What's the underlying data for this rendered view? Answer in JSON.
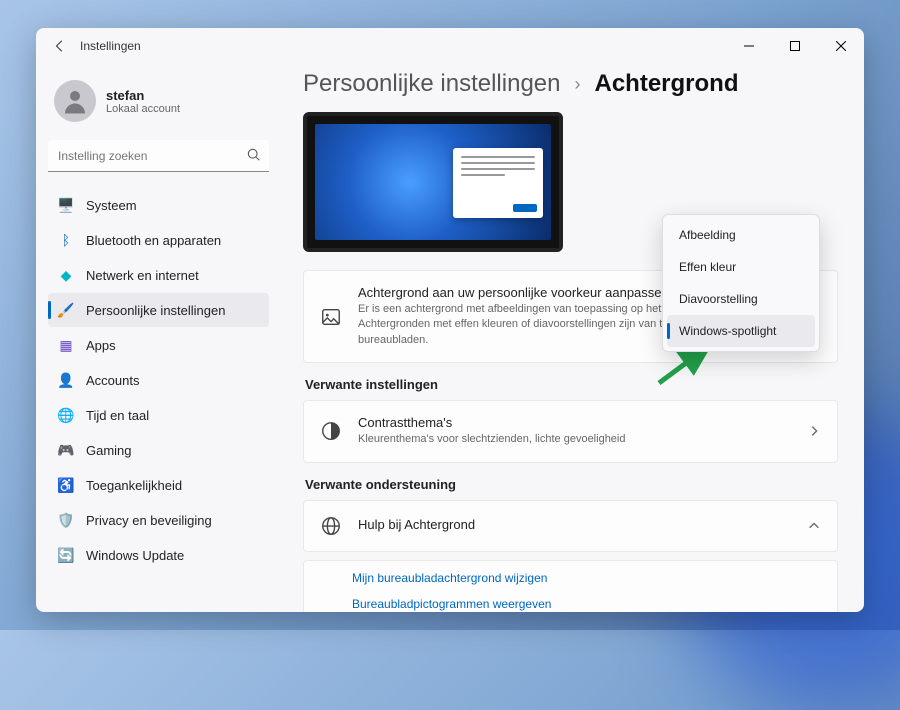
{
  "window": {
    "title": "Instellingen"
  },
  "user": {
    "name": "stefan",
    "subtitle": "Lokaal account"
  },
  "search": {
    "placeholder": "Instelling zoeken"
  },
  "sidebar": {
    "items": [
      {
        "label": "Systeem",
        "icon": "🖥️",
        "color": "#0067c0"
      },
      {
        "label": "Bluetooth en apparaten",
        "icon": "ᛒ",
        "color": "#0067c0"
      },
      {
        "label": "Netwerk en internet",
        "icon": "◆",
        "color": "#00b7c3"
      },
      {
        "label": "Persoonlijke instellingen",
        "icon": "🖌️",
        "color": "#d97706",
        "selected": true
      },
      {
        "label": "Apps",
        "icon": "▦",
        "color": "#6b46c1"
      },
      {
        "label": "Accounts",
        "icon": "👤",
        "color": "#0ea5e9"
      },
      {
        "label": "Tijd en taal",
        "icon": "🌐",
        "color": "#0891b2"
      },
      {
        "label": "Gaming",
        "icon": "🎮",
        "color": "#64748b"
      },
      {
        "label": "Toegankelijkheid",
        "icon": "♿",
        "color": "#0067c0"
      },
      {
        "label": "Privacy en beveiliging",
        "icon": "🛡️",
        "color": "#475569"
      },
      {
        "label": "Windows Update",
        "icon": "🔄",
        "color": "#0ea5e9"
      }
    ]
  },
  "breadcrumb": {
    "parent": "Persoonlijke instellingen",
    "current": "Achtergrond"
  },
  "card1": {
    "title": "Achtergrond aan uw persoonlijke voorkeur aanpassen",
    "desc": "Er is een achtergrond met afbeeldingen van toepassing op het huidige bureaublad. Achtergronden met effen kleuren of diavoorstellingen zijn van toepassing op al uw bureaubladen."
  },
  "dropdown": {
    "options": [
      {
        "label": "Afbeelding"
      },
      {
        "label": "Effen kleur"
      },
      {
        "label": "Diavoorstelling"
      },
      {
        "label": "Windows-spotlight",
        "selected": true
      }
    ]
  },
  "section1": {
    "heading": "Verwante instellingen"
  },
  "card2": {
    "title": "Contrastthema's",
    "desc": "Kleurenthema's voor slechtzienden, lichte gevoeligheid"
  },
  "section2": {
    "heading": "Verwante ondersteuning"
  },
  "card3": {
    "title": "Hulp bij Achtergrond"
  },
  "links": {
    "link1": "Mijn bureaubladachtergrond wijzigen",
    "link2": "Bureaubladpictogrammen weergeven"
  }
}
